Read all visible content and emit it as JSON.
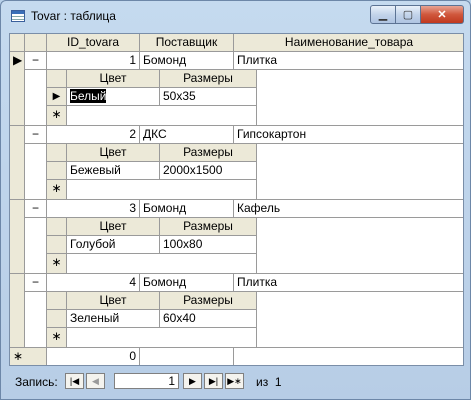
{
  "window": {
    "title": "Tovar : таблица",
    "btn_min": "▁",
    "btn_max": "▢",
    "btn_close": "✕"
  },
  "main": {
    "columns": [
      "ID_tovara",
      "Поставщик",
      "Наименование_товара"
    ],
    "records": [
      {
        "expander": "−",
        "id": "1",
        "supplier": "Бомонд",
        "name": "Плитка",
        "sub": {
          "columns": [
            "Цвет",
            "Размеры"
          ],
          "rows": [
            {
              "color": "Белый",
              "size": "50x35"
            }
          ]
        }
      },
      {
        "expander": "−",
        "id": "2",
        "supplier": "ДКС",
        "name": "Гипсокартон",
        "sub": {
          "columns": [
            "Цвет",
            "Размеры"
          ],
          "rows": [
            {
              "color": "Бежевый",
              "size": "2000x1500"
            }
          ]
        }
      },
      {
        "expander": "−",
        "id": "3",
        "supplier": "Бомонд",
        "name": "Кафель",
        "sub": {
          "columns": [
            "Цвет",
            "Размеры"
          ],
          "rows": [
            {
              "color": "Голубой",
              "size": "100x80"
            }
          ]
        }
      },
      {
        "expander": "−",
        "id": "4",
        "supplier": "Бомонд",
        "name": "Плитка",
        "sub": {
          "columns": [
            "Цвет",
            "Размеры"
          ],
          "rows": [
            {
              "color": "Зеленый",
              "size": "60x40"
            }
          ]
        }
      }
    ],
    "new_row": {
      "marker": "∗",
      "id": "0"
    },
    "current_marker": "▶",
    "new_marker": "∗"
  },
  "navigation": {
    "label": "Запись:",
    "first": "|◀",
    "prev": "◀",
    "current": "1",
    "next": "▶",
    "last": "▶|",
    "new": "▶∗",
    "of_label": "из",
    "total": "1"
  }
}
